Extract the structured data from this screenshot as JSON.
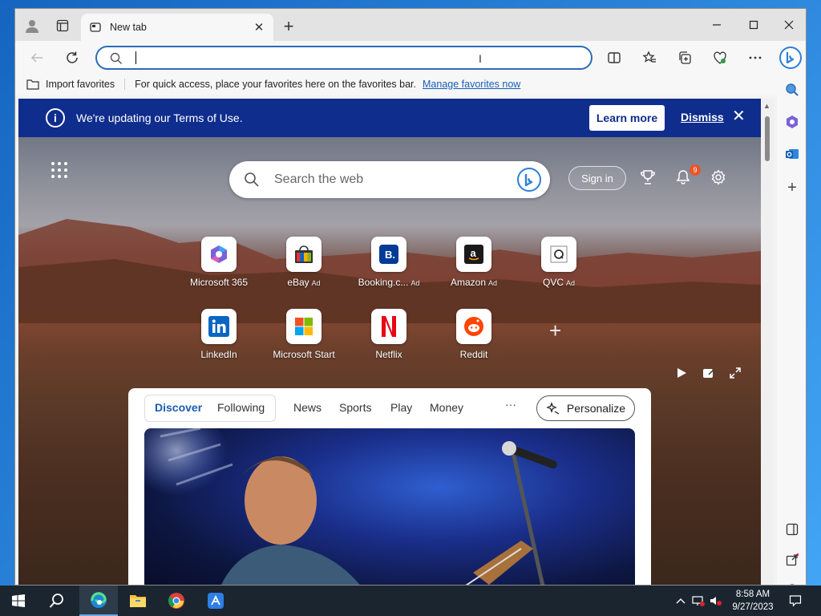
{
  "browser": {
    "tab_title": "New tab",
    "address_value": "",
    "address_placeholder": ""
  },
  "favorites_bar": {
    "import_label": "Import favorites",
    "hint": "For quick access, place your favorites here on the favorites bar.",
    "manage_link": "Manage favorites now"
  },
  "banner": {
    "message": "We're updating our Terms of Use.",
    "learn_more": "Learn more",
    "dismiss": "Dismiss"
  },
  "newtab": {
    "search_placeholder": "Search the web",
    "sign_in": "Sign in",
    "notification_count": "9",
    "tiles_row1": [
      {
        "label": "Microsoft 365",
        "ad": ""
      },
      {
        "label": "eBay",
        "ad": "Ad"
      },
      {
        "label": "Booking.c...",
        "ad": "Ad"
      },
      {
        "label": "Amazon",
        "ad": "Ad"
      },
      {
        "label": "QVC",
        "ad": "Ad"
      }
    ],
    "tiles_row2": [
      {
        "label": "LinkedIn"
      },
      {
        "label": "Microsoft Start"
      },
      {
        "label": "Netflix"
      },
      {
        "label": "Reddit"
      }
    ]
  },
  "feed": {
    "tabs": [
      "Discover",
      "Following",
      "News",
      "Sports",
      "Play",
      "Money"
    ],
    "more": "···",
    "personalize": "Personalize"
  },
  "taskbar": {
    "time": "8:58 AM",
    "date": "9/27/2023"
  },
  "colors": {
    "banner_bg": "#0f2d8c",
    "accent": "#1a5cb3",
    "taskbar_bg": "#1b2530"
  }
}
